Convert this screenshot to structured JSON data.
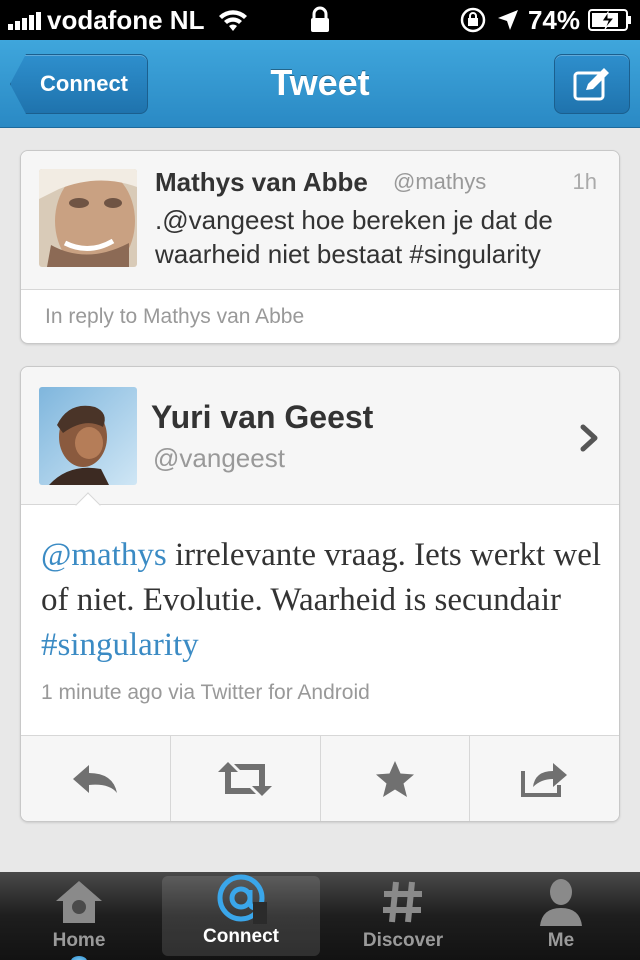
{
  "status_bar": {
    "carrier": "vodafone NL",
    "battery": "74%"
  },
  "nav": {
    "back_label": "Connect",
    "title": "Tweet"
  },
  "reply_tweet": {
    "name": "Mathys van Abbe",
    "handle": "@mathys",
    "time": "1h",
    "text": ".@vangeest hoe bereken je dat de waarheid niet bestaat #singularity",
    "reply_line": "In reply to Mathys van Abbe"
  },
  "main_tweet": {
    "name": "Yuri van Geest",
    "handle": "@vangeest",
    "mention": "@mathys",
    "text_body": " irrelevante vraag. Iets werkt wel of niet. Evolutie. Waarheid is secundair ",
    "hashtag": "#singularity",
    "meta": "1 minute ago via Twitter for Android"
  },
  "actions": [
    "reply-icon",
    "retweet-icon",
    "favorite-icon",
    "share-icon"
  ],
  "tabs": [
    {
      "label": "Home",
      "icon": "home-icon"
    },
    {
      "label": "Connect",
      "icon": "at-icon"
    },
    {
      "label": "Discover",
      "icon": "hash-icon"
    },
    {
      "label": "Me",
      "icon": "person-icon"
    }
  ],
  "colors": {
    "nav_blue": "#3fa6dc",
    "link_blue": "#3b8bc4",
    "tab_active_blue": "#2c8fd0"
  }
}
